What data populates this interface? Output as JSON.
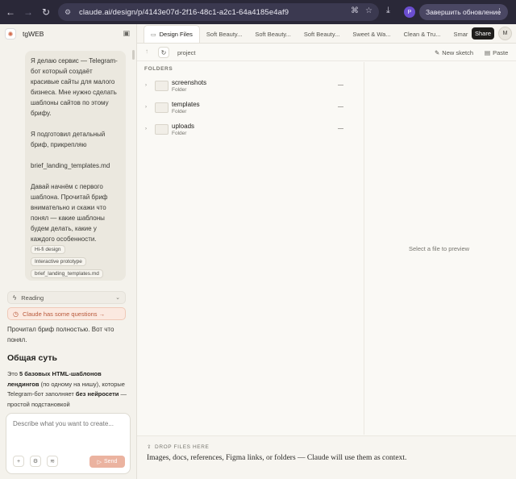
{
  "browser": {
    "url": "claude.ai/design/p/4143e07d-2f16-48c1-a2c1-64a4185e4af9",
    "profile_initial": "P",
    "update_label": "Завершить обновление"
  },
  "sidebar": {
    "project_name": "tgWEB",
    "user_message": [
      "Я делаю сервис — Telegram-бот который создаёт красивые сайты для малого бизнеса. Мне нужно сделать шаблоны сайтов по этому брифу.",
      "Я подготовил детальный бриф, прикрепляю",
      "brief_landing_templates.md",
      "Давай начнём с первого шаблона. Прочитай бриф внимательно и скажи что понял — какие шаблоны будем делать, какие у каждого особенности."
    ],
    "chips": [
      "Hi-fi design",
      "Interactive prototype",
      "brief_landing_templates.md"
    ],
    "reading_label": "Reading",
    "questions_label": "Claude has some questions →",
    "reply": "Прочитал бриф полностью. Вот что понял.",
    "section_title": "Общая суть",
    "body": {
      "p1": "Это ",
      "b1": "5 базовых HTML-шаблонов лендингов",
      "p2": " (по одному на нишу), которые Telegram-бот заполняет ",
      "b2": "без нейросети",
      "p3": " — простой подстановкой"
    },
    "composer_placeholder": "Describe what you want to create...",
    "send_label": "Send"
  },
  "main": {
    "tabs": [
      {
        "label": "Design Files",
        "active": true
      },
      {
        "label": "Soft Beauty..."
      },
      {
        "label": "Soft Beauty..."
      },
      {
        "label": "Soft Beauty..."
      },
      {
        "label": "Sweet & Wa..."
      },
      {
        "label": "Clean & Tru..."
      },
      {
        "label": "Smar"
      }
    ],
    "share_label": "Share",
    "avatar_initial": "M",
    "breadcrumb": "project",
    "new_sketch_label": "New sketch",
    "paste_label": "Paste",
    "folders_label": "FOLDERS",
    "folders": [
      {
        "name": "screenshots",
        "type": "Folder",
        "size": "—"
      },
      {
        "name": "templates",
        "type": "Folder",
        "size": "—"
      },
      {
        "name": "uploads",
        "type": "Folder",
        "size": "—"
      }
    ],
    "preview_placeholder": "Select a file to preview",
    "drop_label": "DROP FILES HERE",
    "drop_desc": "Images, docs, references, Figma links, or folders — Claude will use them as context."
  }
}
